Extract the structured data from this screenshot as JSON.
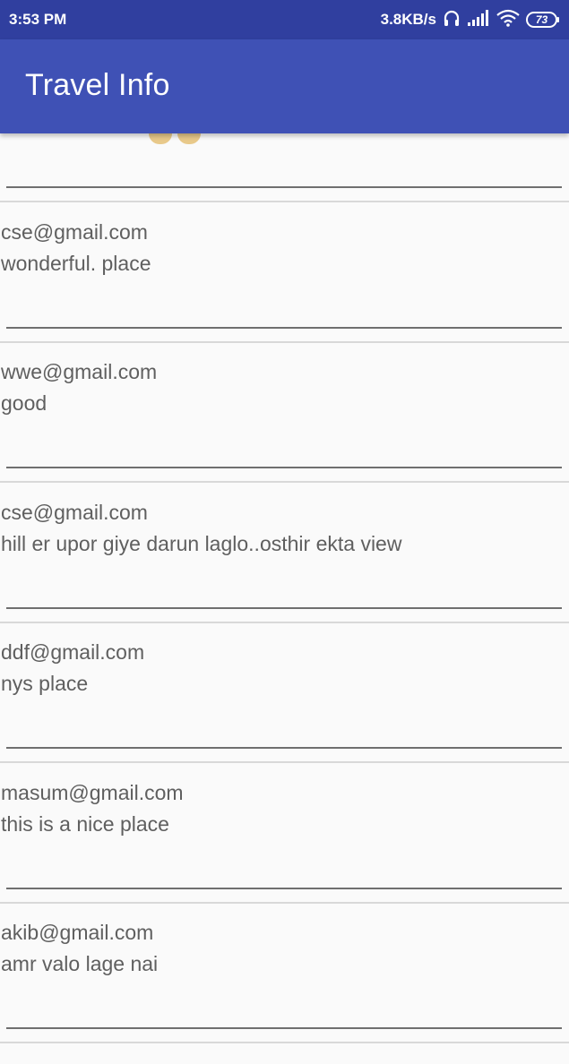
{
  "status_bar": {
    "time": "3:53 PM",
    "net_speed": "3.8KB/s",
    "battery": "73",
    "icons": [
      "headphone-icon",
      "signal-icon",
      "wifi-icon",
      "battery-icon"
    ]
  },
  "app_bar": {
    "title": "Travel Info"
  },
  "reviews": [
    {
      "email": "cse@gmail.com",
      "comment": "wonderful. place"
    },
    {
      "email": "wwe@gmail.com",
      "comment": "good"
    },
    {
      "email": "cse@gmail.com",
      "comment": "hill er upor giye darun laglo..osthir ekta view"
    },
    {
      "email": "ddf@gmail.com",
      "comment": "nys place"
    },
    {
      "email": "masum@gmail.com",
      "comment": "this is a nice place"
    },
    {
      "email": "akib@gmail.com",
      "comment": "amr valo lage nai"
    }
  ]
}
